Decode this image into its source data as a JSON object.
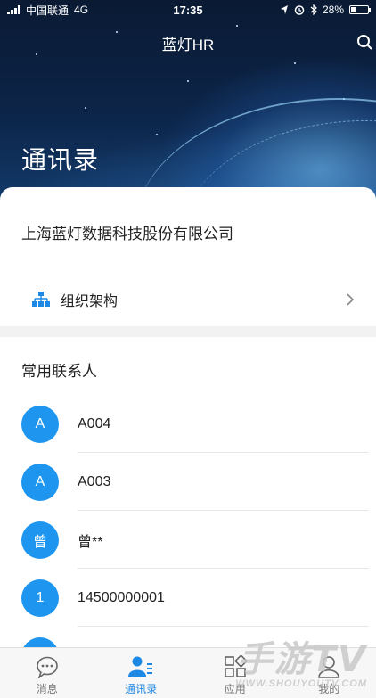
{
  "status_bar": {
    "carrier": "中国联通",
    "network": "4G",
    "time": "17:35",
    "battery": "28%",
    "battery_level": 0.28
  },
  "header": {
    "app_title": "蓝灯HR",
    "page_title": "通讯录",
    "search_icon": "search-icon"
  },
  "company": {
    "name": "上海蓝灯数据科技股份有限公司"
  },
  "org_structure": {
    "label": "组织架构",
    "icon": "org-chart-icon"
  },
  "frequent_contacts": {
    "title": "常用联系人",
    "items": [
      {
        "avatar": "A",
        "name": "A004"
      },
      {
        "avatar": "A",
        "name": "A003"
      },
      {
        "avatar": "曾",
        "name": "曾**"
      },
      {
        "avatar": "1",
        "name": "14500000001"
      },
      {
        "avatar": "",
        "name": ""
      }
    ]
  },
  "tabbar": {
    "items": [
      {
        "label": "消息",
        "icon": "chat-bubble-icon",
        "active": false
      },
      {
        "label": "通讯录",
        "icon": "contacts-icon",
        "active": true
      },
      {
        "label": "应用",
        "icon": "apps-grid-icon",
        "active": false
      },
      {
        "label": "我的",
        "icon": "person-icon",
        "active": false
      }
    ]
  },
  "colors": {
    "accent": "#1e96f0",
    "active_tab": "#1e88e5"
  },
  "watermark": {
    "main": "手游TV",
    "sub": "WWW.SHOUYOUTV.COM"
  }
}
